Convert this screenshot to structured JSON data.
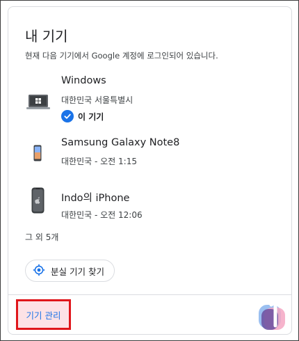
{
  "header": {
    "title": "내 기기",
    "subtitle": "현재 다음 기기에서 Google 계정에 로그인되어 있습니다."
  },
  "devices": [
    {
      "name": "Windows",
      "meta": "대한민국 서울특별시",
      "icon": "laptop-icon",
      "this_device_label": "이 기기"
    },
    {
      "name": "Samsung Galaxy Note8",
      "meta": "대한민국 - 오전 1:15",
      "icon": "android-phone-icon"
    },
    {
      "name": "Indo의 iPhone",
      "meta": "대한민국 - 오전 12:06",
      "icon": "iphone-icon"
    }
  ],
  "more_devices": "그 외 5개",
  "find_device_button": "분실 기기 찾기",
  "footer": {
    "manage_devices_link": "기기 관리"
  },
  "colors": {
    "accent": "#1a73e8",
    "highlight_border": "#e0161b",
    "highlight_fill": "#fde2e6"
  }
}
